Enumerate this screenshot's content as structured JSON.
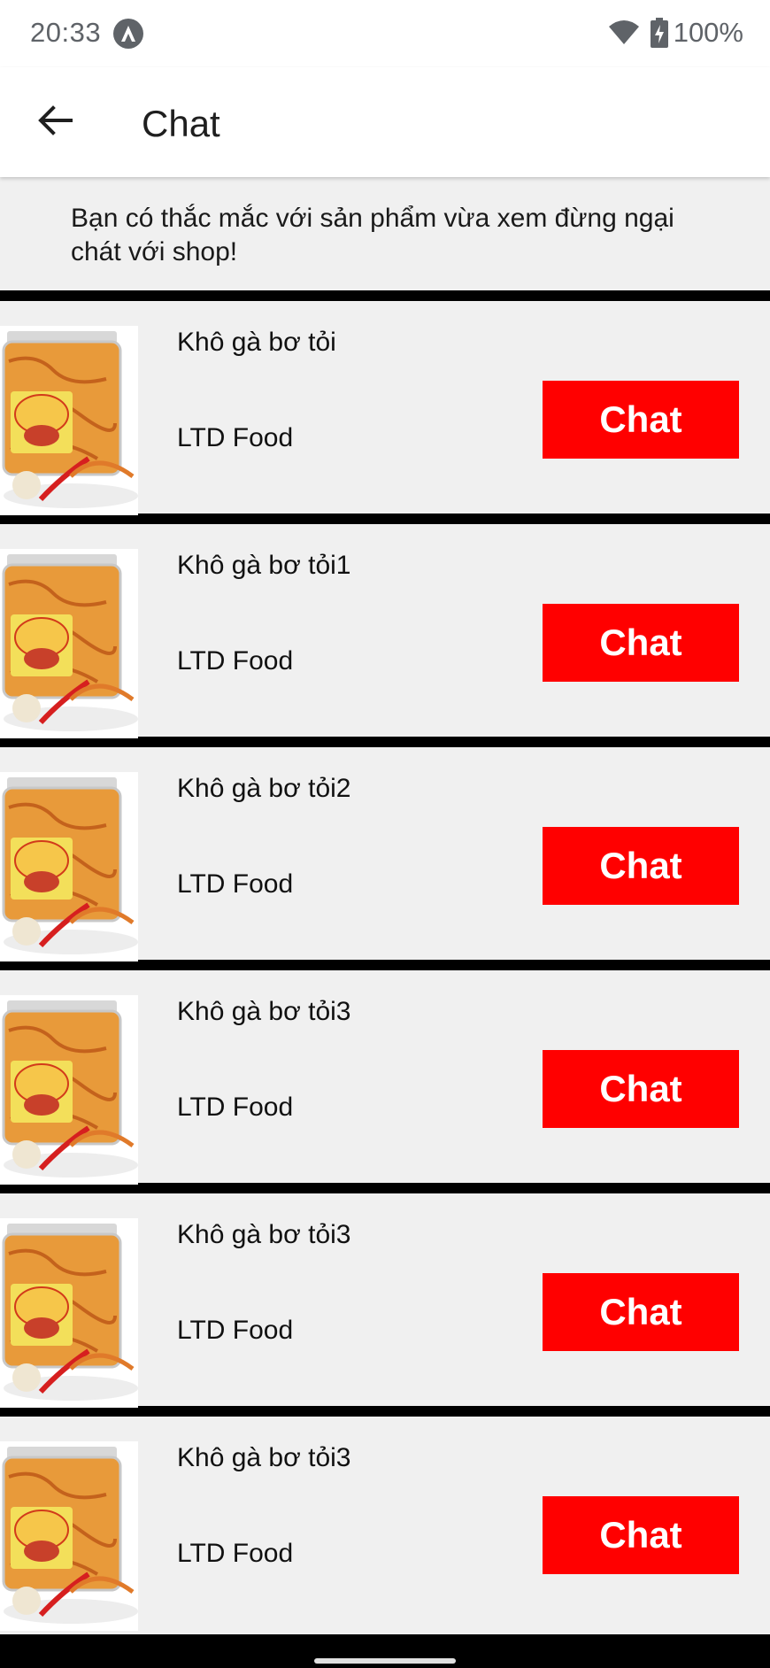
{
  "status_bar": {
    "time": "20:33",
    "battery": "100%",
    "icons": [
      "app-notification-icon",
      "wifi-icon",
      "battery-charging-icon"
    ]
  },
  "app_bar": {
    "title": "Chat",
    "back_icon": "arrow-left-icon"
  },
  "intro": {
    "text": "Bạn có thắc mắc với sản phẩm vừa xem đừng ngại chát với shop!"
  },
  "items": [
    {
      "name": "Khô gà bơ tỏi",
      "shop": "LTD Food",
      "button": "Chat"
    },
    {
      "name": "Khô gà bơ tỏi1",
      "shop": "LTD Food",
      "button": "Chat"
    },
    {
      "name": "Khô gà bơ tỏi2",
      "shop": "LTD Food",
      "button": "Chat"
    },
    {
      "name": "Khô gà bơ tỏi3",
      "shop": "LTD Food",
      "button": "Chat"
    },
    {
      "name": "Khô gà bơ tỏi3",
      "shop": "LTD Food",
      "button": "Chat"
    },
    {
      "name": "Khô gà bơ tỏi3",
      "shop": "LTD Food",
      "button": "Chat"
    }
  ],
  "colors": {
    "accent": "#ff0000",
    "background": "#f0f0f0",
    "divider": "#000000"
  }
}
